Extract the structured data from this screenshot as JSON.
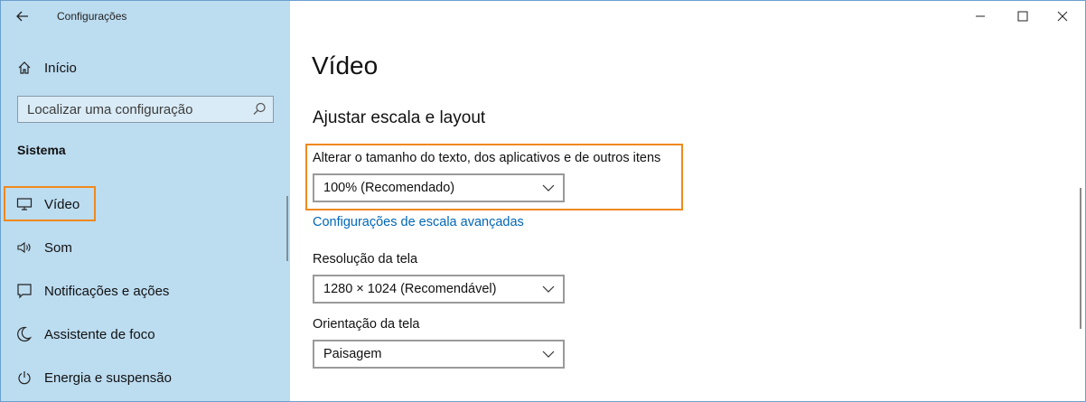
{
  "window": {
    "title": "Configurações"
  },
  "sidebar": {
    "home": {
      "label": "Início",
      "icon": "home-icon"
    },
    "search": {
      "placeholder": "Localizar uma configuração"
    },
    "section": "Sistema",
    "items": [
      {
        "label": "Vídeo",
        "icon": "monitor-icon",
        "selected": true
      },
      {
        "label": "Som",
        "icon": "speaker-icon"
      },
      {
        "label": "Notificações e ações",
        "icon": "notification-icon"
      },
      {
        "label": "Assistente de foco",
        "icon": "moon-icon"
      },
      {
        "label": "Energia e suspensão",
        "icon": "power-icon"
      }
    ]
  },
  "main": {
    "title": "Vídeo",
    "section_title": "Ajustar escala e layout",
    "scale": {
      "label": "Alterar o tamanho do texto, dos aplicativos e de outros itens",
      "value": "100% (Recomendado)"
    },
    "advanced_link": "Configurações de escala avançadas",
    "resolution": {
      "label": "Resolução da tela",
      "value": "1280 × 1024 (Recomendável)"
    },
    "orientation": {
      "label": "Orientação da tela",
      "value": "Paisagem"
    }
  },
  "colors": {
    "sidebar_bg": "#bcdcf0",
    "highlight": "#f0891e",
    "link": "#0067b8"
  }
}
